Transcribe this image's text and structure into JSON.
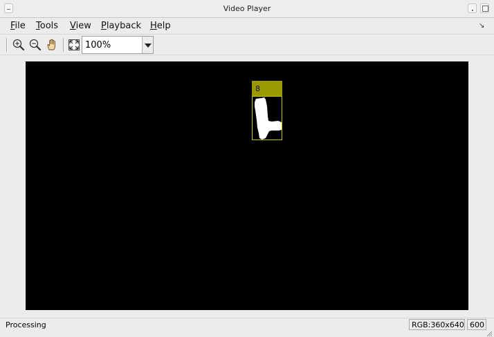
{
  "window": {
    "title": "Video Player"
  },
  "menubar": {
    "items": [
      {
        "label_u": "F",
        "label_rest": "ile"
      },
      {
        "label_u": "T",
        "label_rest": "ools"
      },
      {
        "label_u": "V",
        "label_rest": "iew"
      },
      {
        "label_u": "P",
        "label_rest": "layback"
      },
      {
        "label_u": "H",
        "label_rest": "elp"
      }
    ]
  },
  "toolbar": {
    "tools": [
      "zoom-in-icon",
      "zoom-out-icon",
      "pan-hand-icon",
      "fit-to-window-icon"
    ],
    "zoom": {
      "value": "100%"
    }
  },
  "video": {
    "background_color": "#000000",
    "track": {
      "label": "8",
      "label_color": "#9a9a00",
      "box_color": "#c8c800"
    }
  },
  "statusbar": {
    "text": "Processing",
    "format": "RGB:360x640",
    "frame_count": "600"
  }
}
